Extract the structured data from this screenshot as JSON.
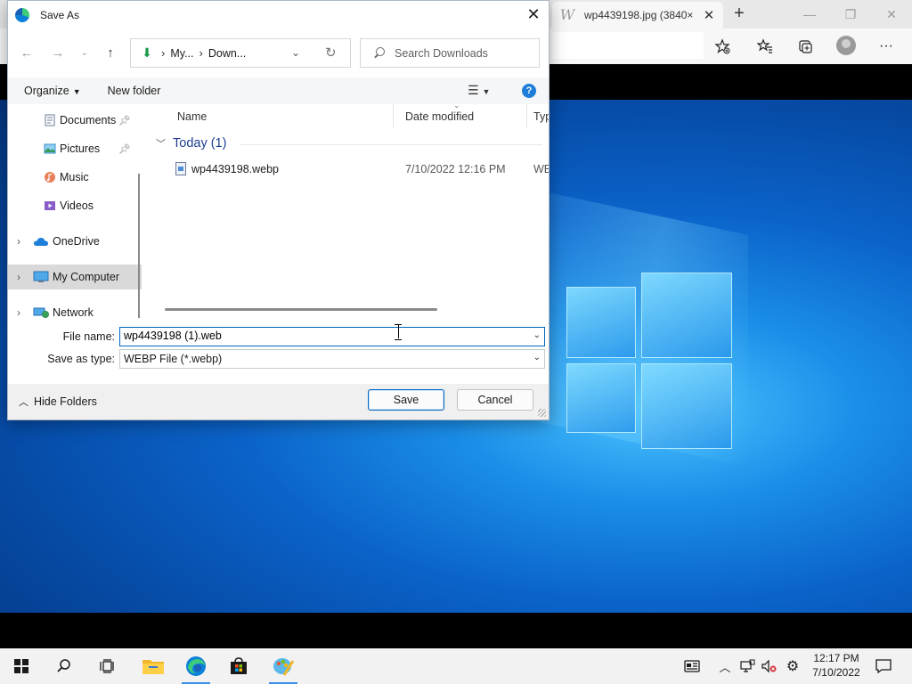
{
  "browser": {
    "tab_title": "wp4439198.jpg (3840×",
    "tab_favicon": "W",
    "new_tab_glyph": "+",
    "minimize_glyph": "—",
    "restore_glyph": "❐",
    "close_glyph": "✕",
    "more_glyph": "···"
  },
  "dialog": {
    "title": "Save As",
    "path": [
      "My...",
      "Down..."
    ],
    "search_placeholder": "Search Downloads",
    "toolbar": {
      "organize": "Organize",
      "new_folder": "New folder"
    },
    "nav": {
      "items": [
        {
          "label": "Documents",
          "icon": "documents-icon",
          "pinned": true
        },
        {
          "label": "Pictures",
          "icon": "pictures-icon",
          "pinned": true
        },
        {
          "label": "Music",
          "icon": "music-icon",
          "pinned": false
        },
        {
          "label": "Videos",
          "icon": "videos-icon",
          "pinned": false
        },
        {
          "label": "OneDrive",
          "icon": "cloud-icon",
          "expandable": true
        },
        {
          "label": "My Computer",
          "icon": "computer-icon",
          "expandable": true,
          "selected": true
        },
        {
          "label": "Network",
          "icon": "network-icon",
          "expandable": true
        }
      ]
    },
    "columns": {
      "name": "Name",
      "date_modified": "Date modified",
      "type": "Type"
    },
    "group": {
      "label": "Today (1)"
    },
    "files": [
      {
        "name": "wp4439198.webp",
        "date": "7/10/2022 12:16 PM",
        "type": "WEBP"
      }
    ],
    "form": {
      "file_name_label": "File name:",
      "file_name_value": "wp4439198 (1).web",
      "save_type_label": "Save as type:",
      "save_type_value": "WEBP File (*.webp)"
    },
    "footer": {
      "hide_folders": "Hide Folders",
      "save": "Save",
      "cancel": "Cancel"
    }
  },
  "taskbar": {
    "time": "12:17 PM",
    "date": "7/10/2022"
  },
  "colors": {
    "accent": "#0067c0",
    "group_header": "#1f3f8f",
    "help": "#1f7ed9",
    "wallpaper": "#0b63c9"
  }
}
